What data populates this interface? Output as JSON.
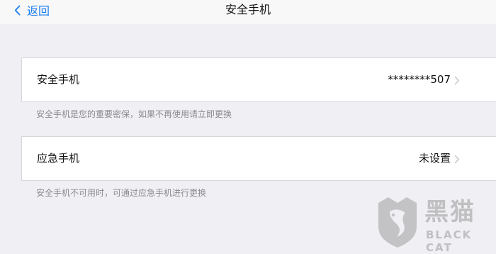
{
  "navbar": {
    "back_label": "返回",
    "title": "安全手机"
  },
  "rows": [
    {
      "label": "安全手机",
      "value": "********507",
      "hint": "安全手机是您的重要密保，如果不再使用请立即更换"
    },
    {
      "label": "应急手机",
      "value": "未设置",
      "hint": "安全手机不可用时，可通过应急手机进行更换"
    }
  ],
  "watermark": {
    "brand": "黑猫",
    "sub": "BLACK CAT"
  },
  "colors": {
    "accent": "#1a7cf0",
    "background": "#efeff4",
    "hint_text": "#8a8a8f",
    "chevron": "#c7c7cc"
  }
}
